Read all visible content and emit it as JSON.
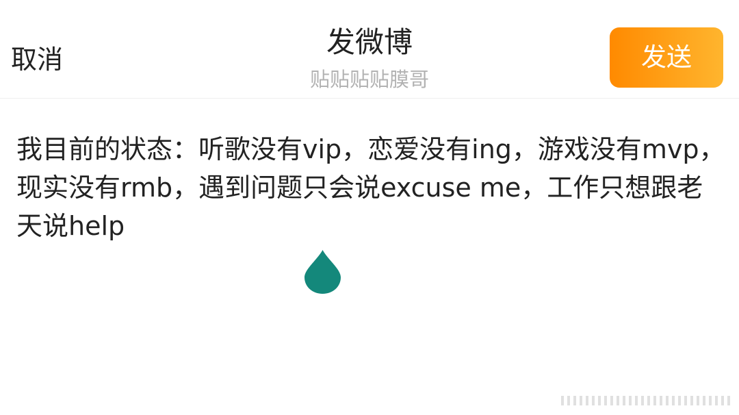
{
  "header": {
    "cancel_label": "取消",
    "title": "发微博",
    "subtitle": "贴贴贴贴膜哥",
    "send_label": "发送"
  },
  "colors": {
    "accent_start": "#ff8a00",
    "accent_end": "#ffb52e",
    "cursor_handle": "#14887b",
    "subtitle_text": "#b2b2b2"
  },
  "composer": {
    "text": "我目前的状态：听歌没有vip，恋爱没有ing，游戏没有mvp，现实没有rmb，遇到问题只会说excuse me，工作只想跟老天说help"
  },
  "icons": {
    "cursor_handle": "teardrop-cursor-handle-icon",
    "watermark": "striped-watermark-icon"
  }
}
